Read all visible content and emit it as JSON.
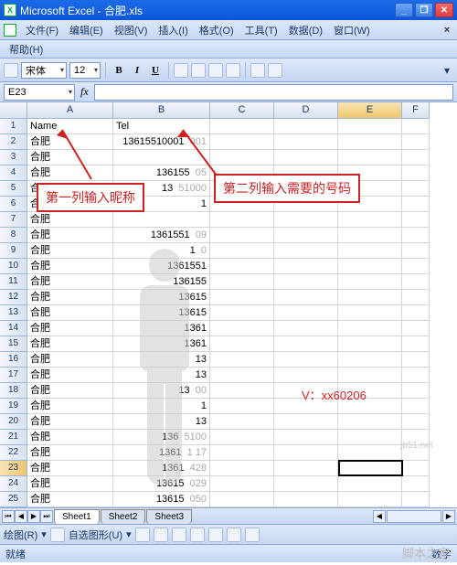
{
  "title": "Microsoft Excel - 合肥.xls",
  "menus": {
    "file": "文件(F)",
    "edit": "编辑(E)",
    "view": "视图(V)",
    "insert": "插入(I)",
    "format": "格式(O)",
    "tools": "工具(T)",
    "data": "数据(D)",
    "window": "窗口(W)",
    "help": "帮助(H)"
  },
  "font": {
    "name": "宋体",
    "size": "12"
  },
  "formats": {
    "bold": "B",
    "italic": "I",
    "underline": "U"
  },
  "namebox": "E23",
  "fx_label": "fx",
  "cols": [
    "A",
    "B",
    "C",
    "D",
    "E",
    "F"
  ],
  "rows": [
    {
      "n": "1",
      "a": "Name",
      "b": "Tel"
    },
    {
      "n": "2",
      "a": "合肥",
      "b": "13615510001"
    },
    {
      "n": "3",
      "a": "合肥",
      "b": ""
    },
    {
      "n": "4",
      "a": "合肥",
      "b": "136155"
    },
    {
      "n": "5",
      "a": "合肥",
      "b": "13"
    },
    {
      "n": "6",
      "a": "合肥",
      "b": "1"
    },
    {
      "n": "7",
      "a": "合肥",
      "b": ""
    },
    {
      "n": "8",
      "a": "合肥",
      "b": "1361551"
    },
    {
      "n": "9",
      "a": "合肥",
      "b": "1"
    },
    {
      "n": "10",
      "a": "合肥",
      "b": "1361551"
    },
    {
      "n": "11",
      "a": "合肥",
      "b": "136155"
    },
    {
      "n": "12",
      "a": "合肥",
      "b": "13615"
    },
    {
      "n": "13",
      "a": "合肥",
      "b": "13615"
    },
    {
      "n": "14",
      "a": "合肥",
      "b": "1361"
    },
    {
      "n": "15",
      "a": "合肥",
      "b": "1361"
    },
    {
      "n": "16",
      "a": "合肥",
      "b": "13"
    },
    {
      "n": "17",
      "a": "合肥",
      "b": "13"
    },
    {
      "n": "18",
      "a": "合肥",
      "b": "13"
    },
    {
      "n": "19",
      "a": "合肥",
      "b": "1"
    },
    {
      "n": "20",
      "a": "合肥",
      "b": "13"
    },
    {
      "n": "21",
      "a": "合肥",
      "b": "136"
    },
    {
      "n": "22",
      "a": "合肥",
      "b": "1361"
    },
    {
      "n": "23",
      "a": "合肥",
      "b": "1361"
    },
    {
      "n": "24",
      "a": "合肥",
      "b": "13615"
    },
    {
      "n": "25",
      "a": "合肥",
      "b": "13615"
    }
  ],
  "row_suffix": {
    "2": "001",
    "4": "05",
    "5": "51000",
    "8": "09",
    "9": "0",
    "18": "00",
    "21": "5100",
    "22": "1 17",
    "23": "428",
    "24": "029",
    "25": "050"
  },
  "annotations": {
    "left": "第一列输入昵称",
    "right": "第二列输入需要的号码"
  },
  "v_text": "V：xx60206",
  "watermark_url": "jb51.net",
  "watermark_brand": "脚本之家",
  "sheets": [
    "Sheet1",
    "Sheet2",
    "Sheet3"
  ],
  "drawbar": {
    "draw": "绘图(R)",
    "autoshape": "自选图形(U)"
  },
  "status": {
    "ready": "就绪",
    "num": "数字"
  }
}
